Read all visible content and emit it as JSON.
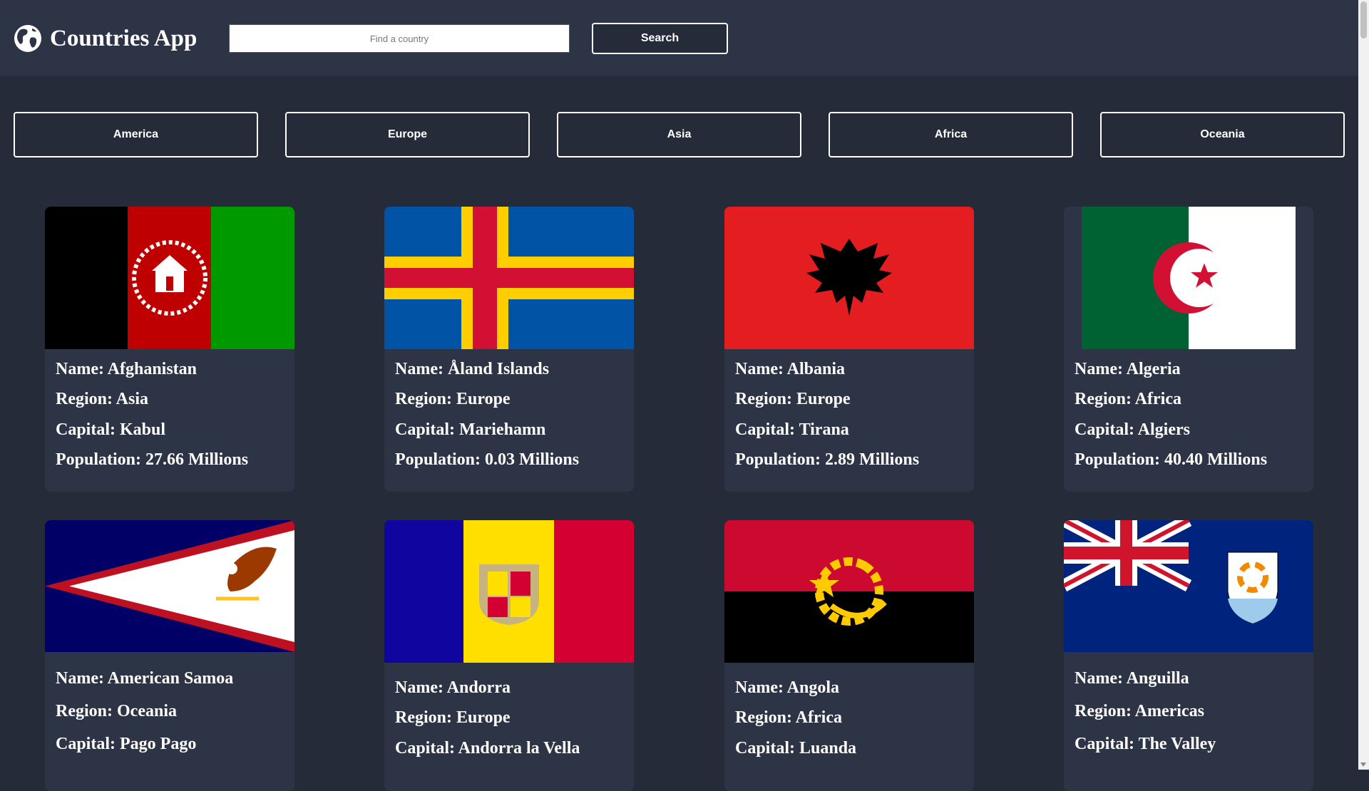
{
  "header": {
    "logo_icon": "globe-icon",
    "app_title": "Countries App",
    "search": {
      "placeholder": "Find a country",
      "value": ""
    },
    "search_button": "Search"
  },
  "regions": [
    "America",
    "Europe",
    "Asia",
    "Africa",
    "Oceania"
  ],
  "countries": [
    {
      "name": "Name: Afghanistan",
      "region": "Region: Asia",
      "capital": "Capital: Kabul",
      "population": "Population: 27.66 Millions",
      "flag": "afghanistan-flag"
    },
    {
      "name": "Name: Åland Islands",
      "region": "Region: Europe",
      "capital": "Capital: Mariehamn",
      "population": "Population: 0.03 Millions",
      "flag": "aland-islands-flag"
    },
    {
      "name": "Name: Albania",
      "region": "Region: Europe",
      "capital": "Capital: Tirana",
      "population": "Population: 2.89 Millions",
      "flag": "albania-flag"
    },
    {
      "name": "Name: Algeria",
      "region": "Region: Africa",
      "capital": "Capital: Algiers",
      "population": "Population: 40.40 Millions",
      "flag": "algeria-flag"
    },
    {
      "name": "Name: American Samoa",
      "region": "Region: Oceania",
      "capital": "Capital: Pago Pago",
      "flag": "american-samoa-flag"
    },
    {
      "name": "Name: Andorra",
      "region": "Region: Europe",
      "capital": "Capital: Andorra la Vella",
      "flag": "andorra-flag"
    },
    {
      "name": "Name: Angola",
      "region": "Region: Africa",
      "capital": "Capital: Luanda",
      "flag": "angola-flag"
    },
    {
      "name": "Name: Anguilla",
      "region": "Region: Americas",
      "capital": "Capital: The Valley",
      "flag": "anguilla-flag"
    }
  ],
  "colors": {
    "page_background": "#252b38",
    "header_background": "#2d3446",
    "card_background": "#2d3446",
    "text": "#ffffff"
  }
}
